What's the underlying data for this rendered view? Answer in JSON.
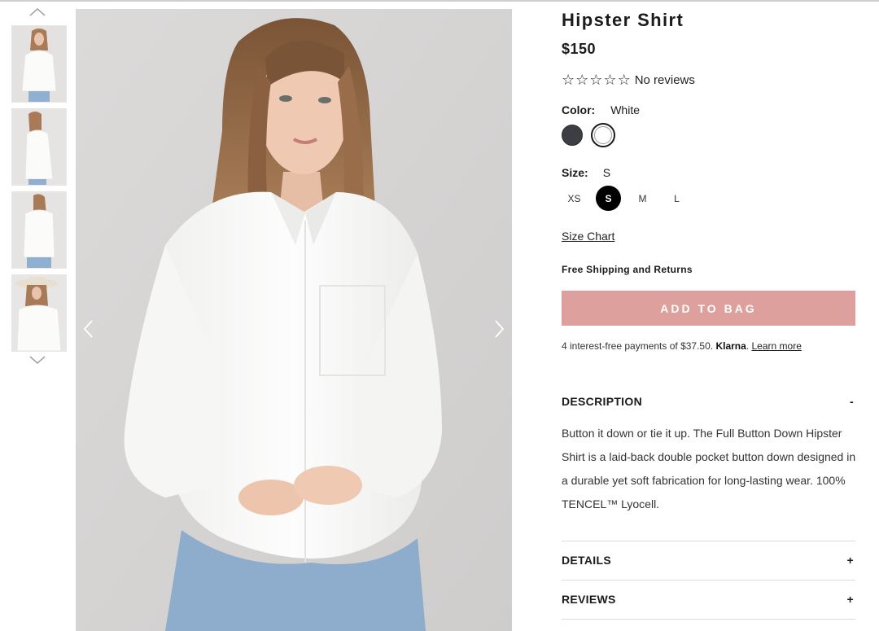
{
  "product": {
    "title": "Hipster Shirt",
    "price": "$150",
    "reviews_text": "No reviews",
    "rating": 0,
    "max_rating": 5
  },
  "color": {
    "label": "Color:",
    "selected": "White",
    "swatches": [
      {
        "name": "Charcoal",
        "hex": "#3d3e44"
      },
      {
        "name": "White",
        "hex": "#ffffff"
      }
    ]
  },
  "size": {
    "label": "Size:",
    "selected": "S",
    "options": [
      "XS",
      "S",
      "M",
      "L"
    ]
  },
  "links": {
    "size_chart": "Size Chart"
  },
  "shipping_note": "Free Shipping and Returns",
  "cta": {
    "add_to_bag": "ADD TO BAG",
    "color": "#dea09d"
  },
  "klarna": {
    "text": "4 interest-free payments of $37.50.",
    "brand": "Klarna",
    "brand_suffix": ".",
    "learn_more": "Learn more"
  },
  "accordion": {
    "description": {
      "title": "DESCRIPTION",
      "toggle": "-",
      "body": "Button it down or tie it up. The Full Button Down Hipster Shirt is a laid-back double pocket button down designed in a durable yet soft fabrication for long-lasting wear. 100% TENCEL™ Lyocell."
    },
    "details": {
      "title": "DETAILS",
      "toggle": "+"
    },
    "reviews": {
      "title": "REVIEWS",
      "toggle": "+"
    }
  },
  "gallery": {
    "thumbnail_count": 4,
    "icons": [
      "chevron-up-icon",
      "chevron-down-icon",
      "chevron-left-icon",
      "chevron-right-icon"
    ]
  }
}
